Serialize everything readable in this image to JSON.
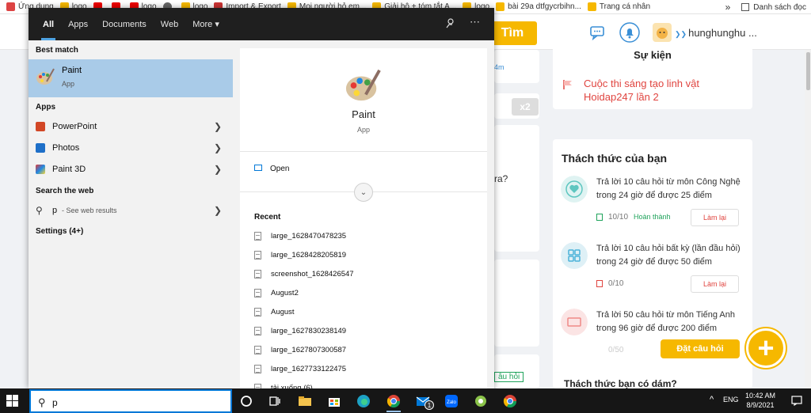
{
  "bookmarks": {
    "items": [
      "Ứng dụng",
      "logo",
      "",
      "",
      "logo",
      "",
      "logo",
      "Import & Export",
      "Mọi người hỏ em...",
      "Giải hộ + tóm tắt A...",
      "logo",
      "bài 29a dtfgycrbihn...",
      "Trang cá nhân"
    ],
    "more": "»",
    "reading_list": "Danh sách đọc"
  },
  "site": {
    "search_button": "Tìm",
    "username": "hunghunghu ...",
    "su_kien_title": "Sự kiện",
    "su_kien_link": "Cuộc thi sáng tạo linh vật Hoidap247 lần 2",
    "thach_thuc_title": "Thách thức của bạn",
    "challenges": [
      {
        "text": "Trả lời 10 câu hỏi  từ môn Công Nghệ trong 24 giờ để được 25 điểm",
        "progress": "10/10",
        "status": "Hoàn thành",
        "button": "Làm lại"
      },
      {
        "text": "Trả lời 10 câu hỏi  bất kỳ (lần đầu hỏi) trong 24 giờ để được 50 điểm",
        "progress": "0/10",
        "status": "",
        "button": "Làm lại"
      },
      {
        "text": "Trả lời 50 câu hỏi  từ môn Tiếng Anh trong 96 giờ để được 200 điểm",
        "progress": "0/50",
        "status": "",
        "button": ""
      }
    ],
    "ask_button": "Đặt câu hỏi",
    "plus": "+",
    "dare_title": "Thách thức bạn có dám?",
    "peek_x2": "x2",
    "peek_ra": "ra?",
    "peek_4m": "4m",
    "peek_tag": "âu hỏi"
  },
  "start_menu": {
    "tabs": [
      "All",
      "Apps",
      "Documents",
      "Web",
      "More ▾"
    ],
    "best_match_heading": "Best match",
    "best_match": {
      "name": "Paint",
      "type": "App"
    },
    "apps_heading": "Apps",
    "apps": [
      {
        "name": "PowerPoint"
      },
      {
        "name": "Photos"
      },
      {
        "name": "Paint 3D"
      }
    ],
    "web_heading": "Search the web",
    "web_query": "p",
    "web_hint": "- See web results",
    "settings": "Settings (4+)",
    "preview": {
      "name": "Paint",
      "type": "App",
      "open": "Open"
    },
    "recent_heading": "Recent",
    "recent": [
      "large_1628470478235",
      "large_1628428205819",
      "screenshot_1628426547",
      "August2",
      "August",
      "large_1627830238149",
      "large_1627807300587",
      "large_1627733122475",
      "tải xuống (6)"
    ]
  },
  "taskbar": {
    "search_value": "p",
    "lang": "ENG",
    "time": "10:42 AM",
    "date": "8/9/2021",
    "badge": "1"
  },
  "colors": {
    "accent": "#f6b800",
    "taskbar": "#161616",
    "best_match_bg": "#a9cbe8"
  }
}
